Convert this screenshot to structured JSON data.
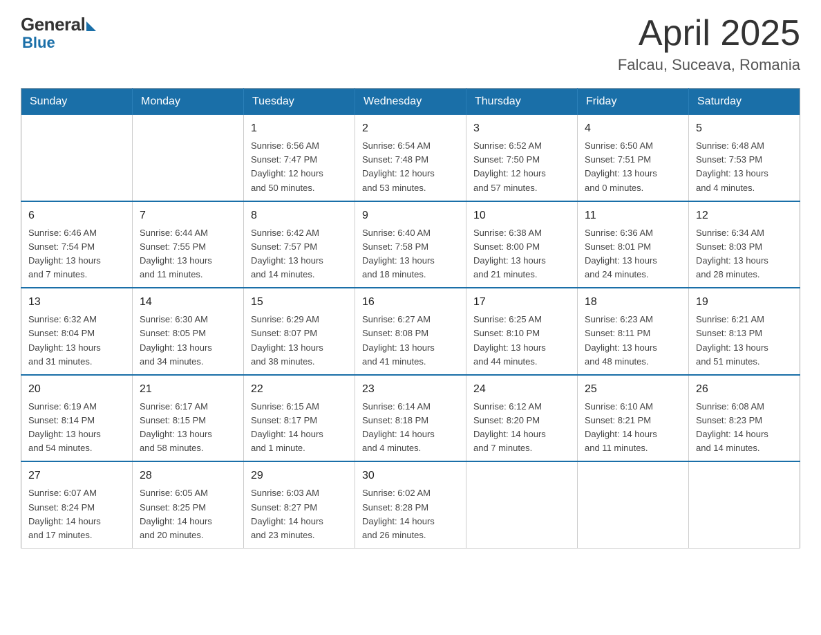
{
  "header": {
    "logo_general": "General",
    "logo_blue": "Blue",
    "month_title": "April 2025",
    "location": "Falcau, Suceava, Romania"
  },
  "weekdays": [
    "Sunday",
    "Monday",
    "Tuesday",
    "Wednesday",
    "Thursday",
    "Friday",
    "Saturday"
  ],
  "weeks": [
    [
      {
        "day": "",
        "info": ""
      },
      {
        "day": "",
        "info": ""
      },
      {
        "day": "1",
        "info": "Sunrise: 6:56 AM\nSunset: 7:47 PM\nDaylight: 12 hours\nand 50 minutes."
      },
      {
        "day": "2",
        "info": "Sunrise: 6:54 AM\nSunset: 7:48 PM\nDaylight: 12 hours\nand 53 minutes."
      },
      {
        "day": "3",
        "info": "Sunrise: 6:52 AM\nSunset: 7:50 PM\nDaylight: 12 hours\nand 57 minutes."
      },
      {
        "day": "4",
        "info": "Sunrise: 6:50 AM\nSunset: 7:51 PM\nDaylight: 13 hours\nand 0 minutes."
      },
      {
        "day": "5",
        "info": "Sunrise: 6:48 AM\nSunset: 7:53 PM\nDaylight: 13 hours\nand 4 minutes."
      }
    ],
    [
      {
        "day": "6",
        "info": "Sunrise: 6:46 AM\nSunset: 7:54 PM\nDaylight: 13 hours\nand 7 minutes."
      },
      {
        "day": "7",
        "info": "Sunrise: 6:44 AM\nSunset: 7:55 PM\nDaylight: 13 hours\nand 11 minutes."
      },
      {
        "day": "8",
        "info": "Sunrise: 6:42 AM\nSunset: 7:57 PM\nDaylight: 13 hours\nand 14 minutes."
      },
      {
        "day": "9",
        "info": "Sunrise: 6:40 AM\nSunset: 7:58 PM\nDaylight: 13 hours\nand 18 minutes."
      },
      {
        "day": "10",
        "info": "Sunrise: 6:38 AM\nSunset: 8:00 PM\nDaylight: 13 hours\nand 21 minutes."
      },
      {
        "day": "11",
        "info": "Sunrise: 6:36 AM\nSunset: 8:01 PM\nDaylight: 13 hours\nand 24 minutes."
      },
      {
        "day": "12",
        "info": "Sunrise: 6:34 AM\nSunset: 8:03 PM\nDaylight: 13 hours\nand 28 minutes."
      }
    ],
    [
      {
        "day": "13",
        "info": "Sunrise: 6:32 AM\nSunset: 8:04 PM\nDaylight: 13 hours\nand 31 minutes."
      },
      {
        "day": "14",
        "info": "Sunrise: 6:30 AM\nSunset: 8:05 PM\nDaylight: 13 hours\nand 34 minutes."
      },
      {
        "day": "15",
        "info": "Sunrise: 6:29 AM\nSunset: 8:07 PM\nDaylight: 13 hours\nand 38 minutes."
      },
      {
        "day": "16",
        "info": "Sunrise: 6:27 AM\nSunset: 8:08 PM\nDaylight: 13 hours\nand 41 minutes."
      },
      {
        "day": "17",
        "info": "Sunrise: 6:25 AM\nSunset: 8:10 PM\nDaylight: 13 hours\nand 44 minutes."
      },
      {
        "day": "18",
        "info": "Sunrise: 6:23 AM\nSunset: 8:11 PM\nDaylight: 13 hours\nand 48 minutes."
      },
      {
        "day": "19",
        "info": "Sunrise: 6:21 AM\nSunset: 8:13 PM\nDaylight: 13 hours\nand 51 minutes."
      }
    ],
    [
      {
        "day": "20",
        "info": "Sunrise: 6:19 AM\nSunset: 8:14 PM\nDaylight: 13 hours\nand 54 minutes."
      },
      {
        "day": "21",
        "info": "Sunrise: 6:17 AM\nSunset: 8:15 PM\nDaylight: 13 hours\nand 58 minutes."
      },
      {
        "day": "22",
        "info": "Sunrise: 6:15 AM\nSunset: 8:17 PM\nDaylight: 14 hours\nand 1 minute."
      },
      {
        "day": "23",
        "info": "Sunrise: 6:14 AM\nSunset: 8:18 PM\nDaylight: 14 hours\nand 4 minutes."
      },
      {
        "day": "24",
        "info": "Sunrise: 6:12 AM\nSunset: 8:20 PM\nDaylight: 14 hours\nand 7 minutes."
      },
      {
        "day": "25",
        "info": "Sunrise: 6:10 AM\nSunset: 8:21 PM\nDaylight: 14 hours\nand 11 minutes."
      },
      {
        "day": "26",
        "info": "Sunrise: 6:08 AM\nSunset: 8:23 PM\nDaylight: 14 hours\nand 14 minutes."
      }
    ],
    [
      {
        "day": "27",
        "info": "Sunrise: 6:07 AM\nSunset: 8:24 PM\nDaylight: 14 hours\nand 17 minutes."
      },
      {
        "day": "28",
        "info": "Sunrise: 6:05 AM\nSunset: 8:25 PM\nDaylight: 14 hours\nand 20 minutes."
      },
      {
        "day": "29",
        "info": "Sunrise: 6:03 AM\nSunset: 8:27 PM\nDaylight: 14 hours\nand 23 minutes."
      },
      {
        "day": "30",
        "info": "Sunrise: 6:02 AM\nSunset: 8:28 PM\nDaylight: 14 hours\nand 26 minutes."
      },
      {
        "day": "",
        "info": ""
      },
      {
        "day": "",
        "info": ""
      },
      {
        "day": "",
        "info": ""
      }
    ]
  ]
}
